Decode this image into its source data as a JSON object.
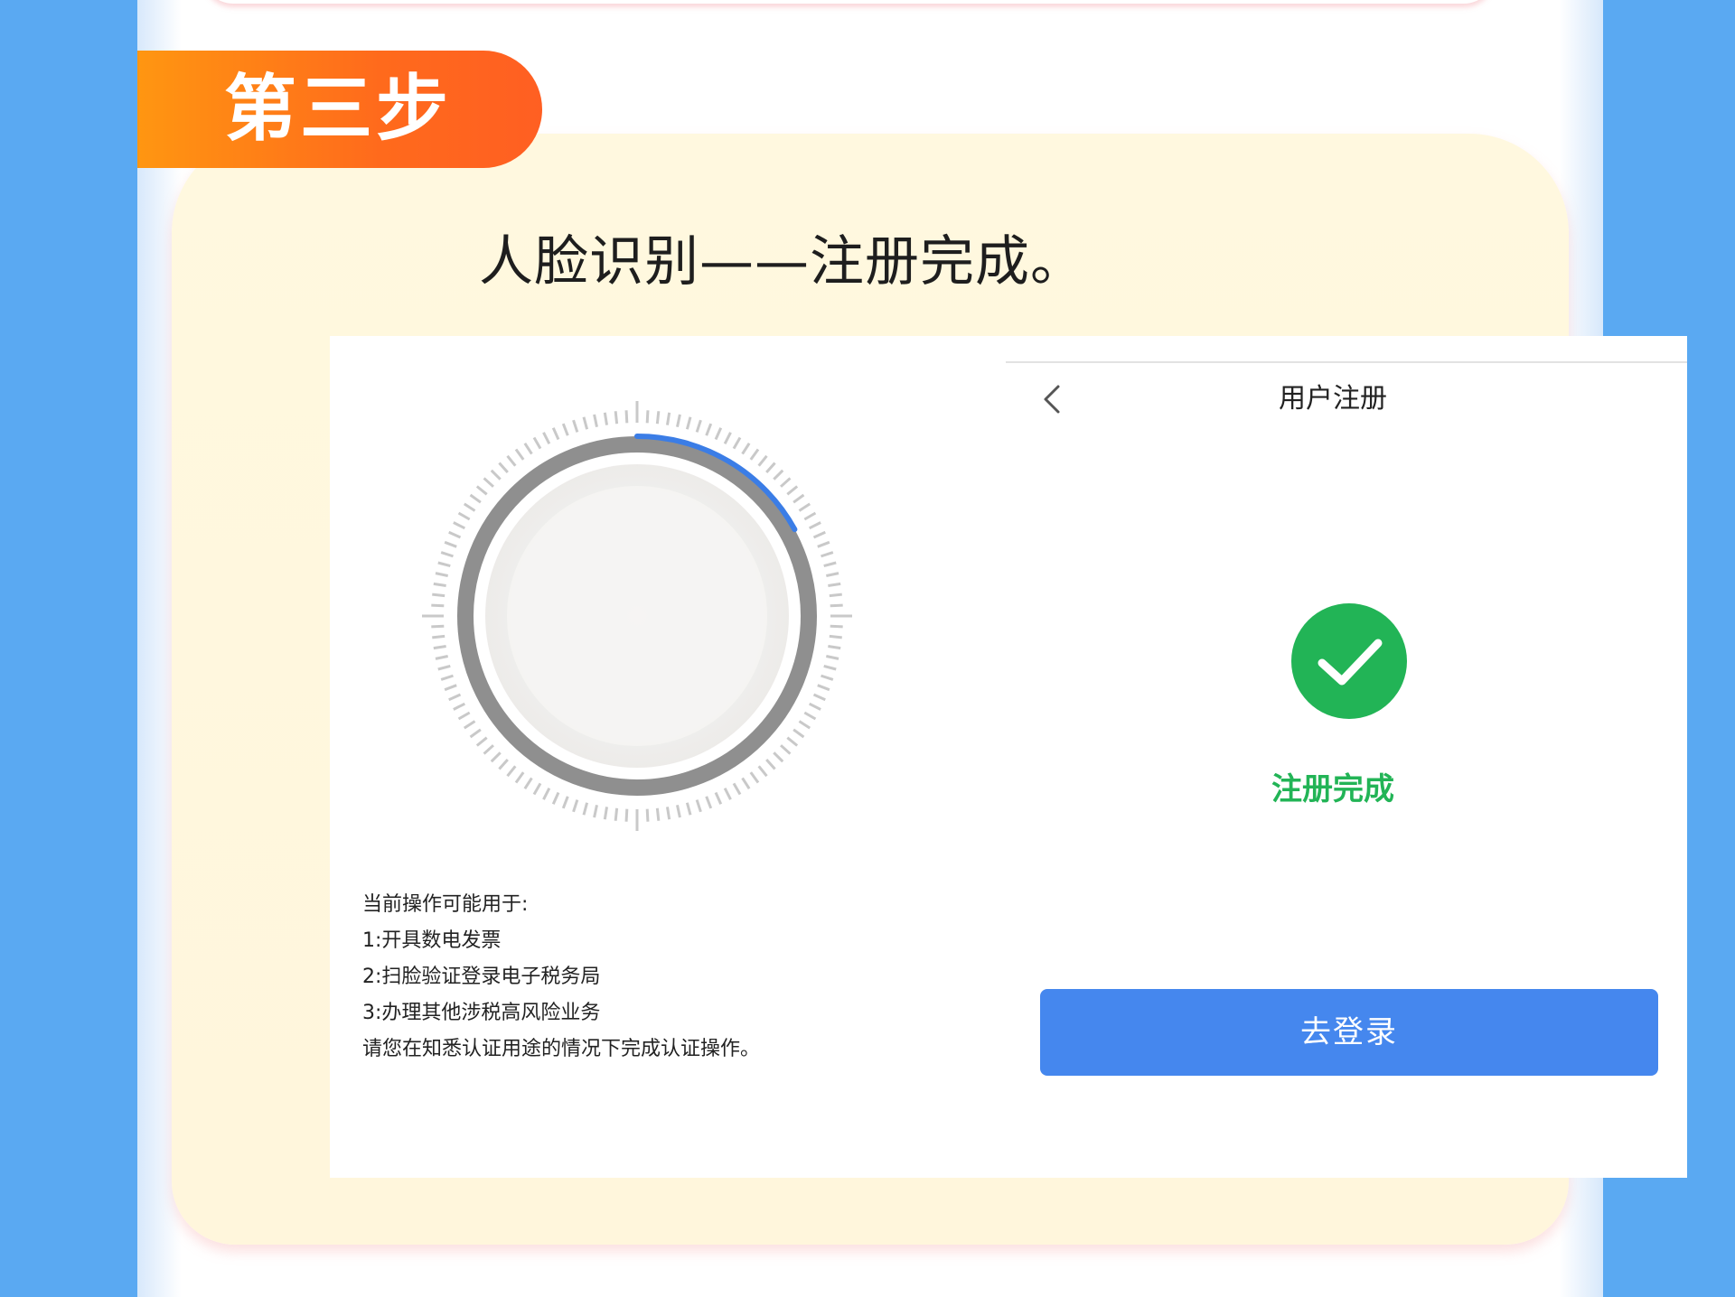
{
  "step": {
    "title": "第三步"
  },
  "headline": "人脸识别——注册完成。",
  "face_panel": {
    "progress_fraction": 0.17,
    "notes": [
      "当前操作可能用于:",
      "1:开具数电发票",
      "2:扫脸验证登录电子税务局",
      "3:办理其他涉税高风险业务",
      "请您在知悉认证用途的情况下完成认证操作。"
    ]
  },
  "register_panel": {
    "title": "用户注册",
    "status_text": "注册完成",
    "button_label": "去登录",
    "back_icon": "chevron-left-icon",
    "status_icon": "check-circle-icon"
  },
  "colors": {
    "page_bg": "#5aa9f2",
    "tab_orange": "#ff7a1a",
    "success_green": "#22b456",
    "button_blue": "#4587ee",
    "progress_blue": "#3b7de6"
  }
}
